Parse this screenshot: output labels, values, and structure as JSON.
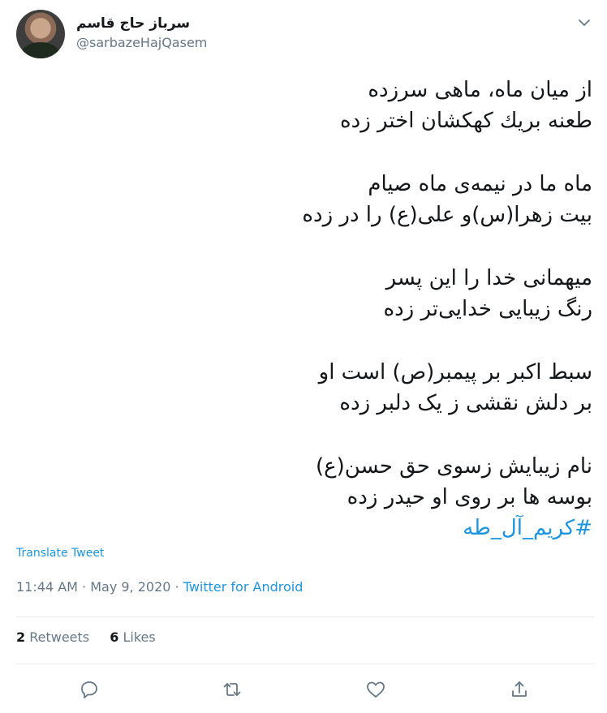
{
  "author": {
    "display_name": "سرباز حاج قاسم",
    "handle": "@sarbazeHajQasem"
  },
  "tweet": {
    "lines": [
      "از میان ماه، ماهی سرزده",
      "طعنه بریك کهکشان اختر زده",
      "",
      "ماه ما در نیمه‌ی ماه صیام",
      "بیت زهرا(س)و علی(ع) را در زده",
      "",
      "میهمانی خدا را این پسر",
      "رنگ زیبایی خدایی‌تر زده",
      "",
      "سبط اکبر بر پیمبر(ص) است او",
      "بر دلش نقشی ز یک دلبر زده",
      "",
      "نام زیبایش زسوی حق حسن(ع)",
      "بوسه ها بر روی او حیدر زده"
    ],
    "hashtag": "#کریم_آل_طه"
  },
  "translate_label": "Translate Tweet",
  "timestamp": "11:44 AM · May 9, 2020 · ",
  "source": "Twitter for Android",
  "stats": {
    "retweets_count": "2",
    "retweets_label": "Retweets",
    "likes_count": "6",
    "likes_label": "Likes"
  },
  "icons": [
    "chevron-down-icon",
    "reply-icon",
    "retweet-icon",
    "like-icon",
    "share-icon"
  ],
  "colors": {
    "accent": "#1b95e0",
    "muted": "#657786",
    "text": "#14171a",
    "icon": "#657786"
  }
}
